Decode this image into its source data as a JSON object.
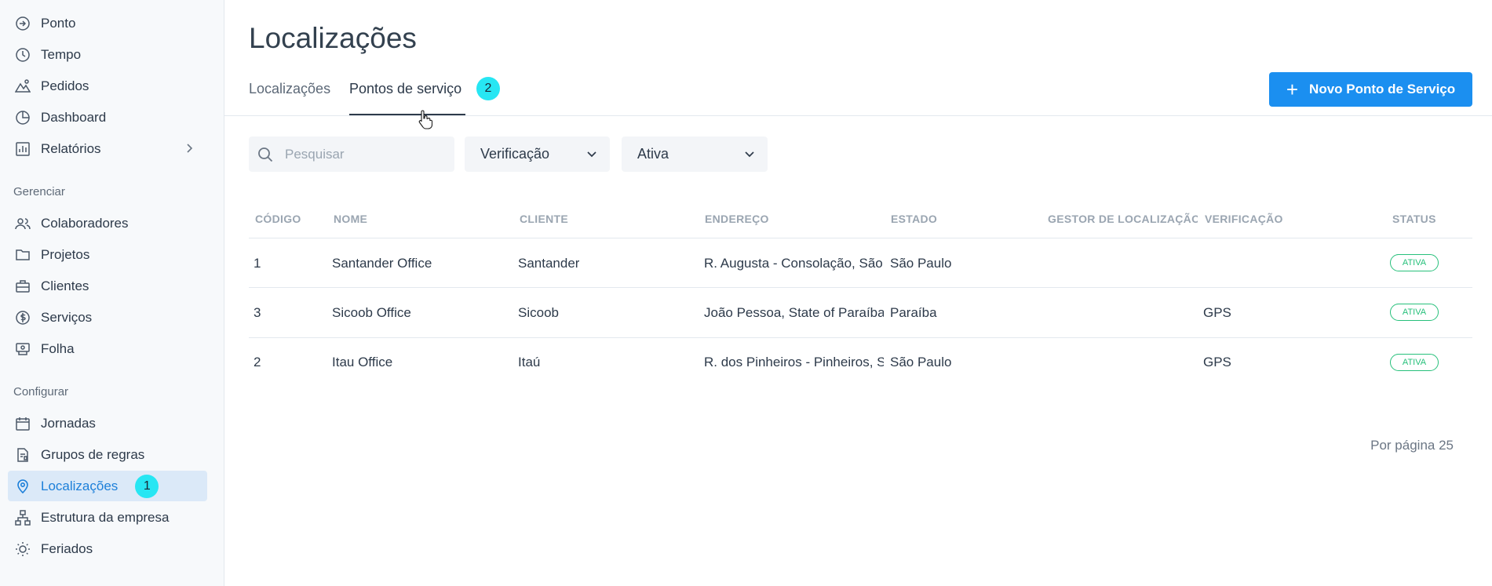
{
  "sidebar": {
    "items": [
      {
        "label": "Ponto",
        "icon": "clock-in-icon"
      },
      {
        "label": "Tempo",
        "icon": "clock-icon"
      },
      {
        "label": "Pedidos",
        "icon": "mountain-icon"
      },
      {
        "label": "Dashboard",
        "icon": "pie-chart-icon"
      },
      {
        "label": "Relatórios",
        "icon": "bar-chart-icon"
      }
    ],
    "manage_label": "Gerenciar",
    "manage_items": [
      {
        "label": "Colaboradores",
        "icon": "users-icon"
      },
      {
        "label": "Projetos",
        "icon": "folder-icon"
      },
      {
        "label": "Clientes",
        "icon": "briefcase-icon"
      },
      {
        "label": "Serviços",
        "icon": "dollar-circle-icon"
      },
      {
        "label": "Folha",
        "icon": "payroll-icon"
      }
    ],
    "config_label": "Configurar",
    "config_items": [
      {
        "label": "Jornadas",
        "icon": "calendar-icon"
      },
      {
        "label": "Grupos de regras",
        "icon": "document-rules-icon"
      },
      {
        "label": "Localizações",
        "icon": "location-pin-icon",
        "badge": "1"
      },
      {
        "label": "Estrutura da empresa",
        "icon": "org-chart-icon"
      },
      {
        "label": "Feriados",
        "icon": "sun-icon"
      }
    ]
  },
  "header": {
    "title": "Localizações",
    "tabs": [
      {
        "label": "Localizações"
      },
      {
        "label": "Pontos de serviço",
        "badge": "2"
      }
    ],
    "new_button": "Novo Ponto de Serviço"
  },
  "filters": {
    "search_placeholder": "Pesquisar",
    "verification": "Verificação",
    "status": "Ativa"
  },
  "table": {
    "columns": [
      "CÓDIGO",
      "NOME",
      "CLIENTE",
      "ENDEREÇO",
      "ESTADO",
      "GESTOR DE LOCALIZAÇÃO",
      "VERIFICAÇÃO",
      "STATUS"
    ],
    "rows": [
      {
        "code": "1",
        "name": "Santander Office",
        "client": "Santander",
        "address": "R. Augusta - Consolação, São Paulo",
        "state": "São Paulo",
        "manager": "",
        "verification": "",
        "status": "ATIVA"
      },
      {
        "code": "3",
        "name": "Sicoob Office",
        "client": "Sicoob",
        "address": "João Pessoa, State of Paraíba",
        "state": "Paraíba",
        "manager": "",
        "verification": "GPS",
        "status": "ATIVA"
      },
      {
        "code": "2",
        "name": "Itau Office",
        "client": "Itaú",
        "address": "R. dos Pinheiros - Pinheiros, São Paulo",
        "state": "São Paulo",
        "manager": "",
        "verification": "GPS",
        "status": "ATIVA"
      }
    ]
  },
  "pagination": {
    "per_page_label": "Por página 25"
  },
  "colors": {
    "accent": "#1b8ff0",
    "badge": "#27e6f3",
    "status": "#27c07b",
    "active_nav_bg": "#dbe9f8"
  }
}
